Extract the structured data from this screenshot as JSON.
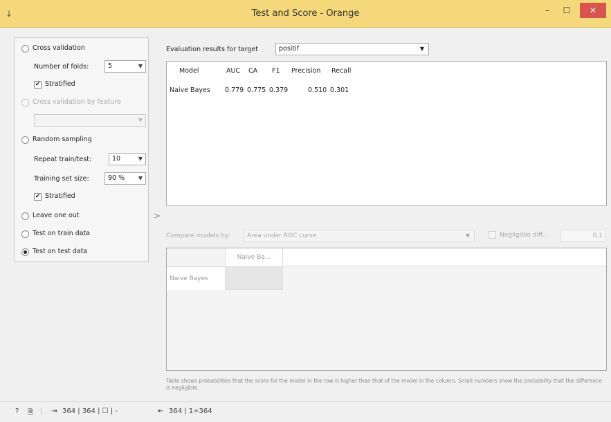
{
  "window": {
    "title": "Test and Score - Orange",
    "minimize": "–",
    "maximize": "☐",
    "close": "✕",
    "app_icon": "↓"
  },
  "sampling": {
    "cross_validation": "Cross validation",
    "folds_label": "Number of folds:",
    "folds_value": "5",
    "stratified_1": "Stratified",
    "cv_feature": "Cross validation by feature",
    "random_sampling": "Random sampling",
    "repeat_label": "Repeat train/test:",
    "repeat_value": "10",
    "train_size_label": "Training set size:",
    "train_size_value": "90 %",
    "stratified_2": "Stratified",
    "leave_one_out": "Leave one out",
    "test_on_train": "Test on train data",
    "test_on_test": "Test on test data",
    "selected": "Test on test data"
  },
  "target": {
    "label": "Evaluation results for target",
    "value": "positif"
  },
  "results": {
    "headers": [
      "Model",
      "AUC",
      "CA",
      "F1",
      "Precision",
      "Recall"
    ],
    "rows": [
      [
        "Naive Bayes",
        "0.779",
        "0.775",
        "0.379",
        "0.510",
        "0.301"
      ]
    ]
  },
  "compare": {
    "label": "Compare models by:",
    "value": "Area under ROC curve",
    "negligible_label": "Negligible diff.:",
    "negligible_value": "0.1",
    "col_header": "Naive Ba...",
    "row_header": "Naive Bayes",
    "note": "Table shows probabilities that the score for the model in the row is higher than that of the model in the column. Small numbers show the probability that the difference is negligible."
  },
  "status": {
    "help": "?",
    "doc": "🗎",
    "input": "364 | 364 | ☐ | -",
    "output": "364 | 1÷364"
  },
  "icons": {
    "help": "help-icon",
    "doc": "document-icon",
    "input": "input-icon",
    "output": "output-icon",
    "collapse": "chevron-right-icon"
  }
}
